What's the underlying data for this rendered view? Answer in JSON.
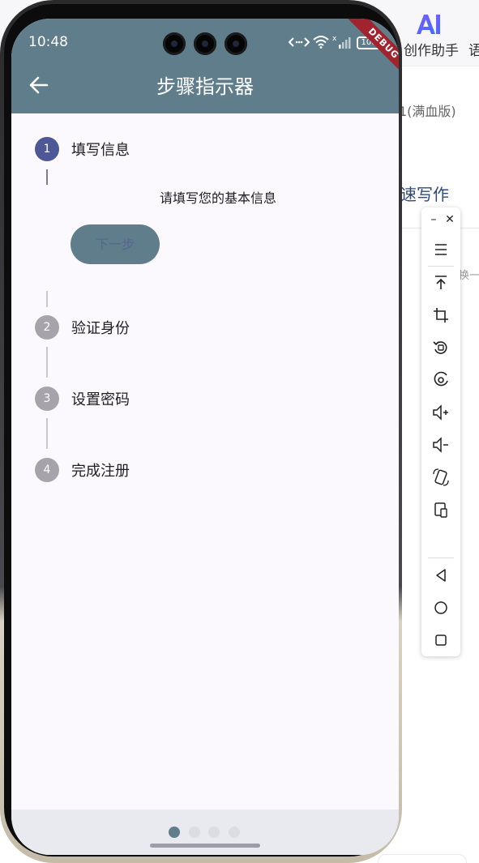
{
  "background_app": {
    "ai_label": "创作助手",
    "lang_label": "语",
    "model_label": "1(满血版)",
    "write_label": "速写作",
    "fragment_text": "换一"
  },
  "status_bar": {
    "time": "10:48",
    "battery": "100"
  },
  "debug_banner": "DEBUG",
  "app_bar": {
    "title": "步骤指示器"
  },
  "stepper": {
    "steps": [
      {
        "number": "1",
        "title": "填写信息",
        "active": true
      },
      {
        "number": "2",
        "title": "验证身份",
        "active": false
      },
      {
        "number": "3",
        "title": "设置密码",
        "active": false
      },
      {
        "number": "4",
        "title": "完成注册",
        "active": false
      }
    ],
    "current_content": "请填写您的基本信息",
    "next_button": "下一步"
  },
  "nav": {
    "dots": 4,
    "active_dot": 0
  },
  "toolbar": {
    "icons": [
      "minimize-icon",
      "close-icon",
      "menu-icon",
      "pin-top-icon",
      "crop-icon",
      "rotate-icon",
      "screenshot-icon",
      "volume-up-icon",
      "volume-down-icon",
      "rotate-device-icon",
      "device-icon",
      "back-icon",
      "home-icon",
      "recents-icon"
    ]
  },
  "colors": {
    "app_bar": "#607d8b",
    "active_step": "#4e5896",
    "inactive_step": "#a6a4aa",
    "screen_bg": "#fbf8fe",
    "debug_ribbon": "#a0232e"
  }
}
